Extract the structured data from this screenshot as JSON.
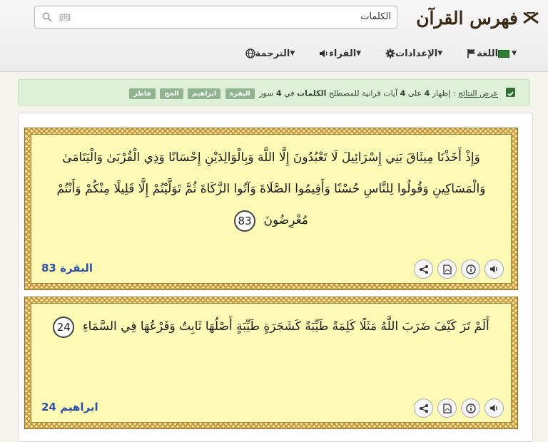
{
  "header": {
    "logo": "فهرس القرآن",
    "search": {
      "value": "الكلمات"
    },
    "nav": [
      {
        "label": "الترجمة",
        "icon": "globe-icon"
      },
      {
        "label": "القراء",
        "icon": "speaker-icon"
      },
      {
        "label": "الإعدادات",
        "icon": "gear-icon"
      },
      {
        "label": "اللغة",
        "icon": "flag-icon"
      }
    ]
  },
  "alert": {
    "label": "عرض النتائج",
    "p1": ": إظهار",
    "shown": "4",
    "p2": "على",
    "total": "4",
    "p3": "آيات قرانية للمصطلح",
    "term": "الكلمات",
    "p4": "في",
    "surah_count": "4",
    "p5": "سور",
    "tags": [
      "البقرة",
      "ابراهيم",
      "الحج",
      "فاطر"
    ]
  },
  "verses": [
    {
      "text": "وَإِذْ أَخَذْنَا مِيثَاقَ بَنِي إِسْرَائِيلَ لَا تَعْبُدُونَ إِلَّا اللَّهَ وَبِالْوَالِدَيْنِ إِحْسَانًا وَذِي الْقُرْبَىٰ وَالْيَتَامَىٰ وَالْمَسَاكِينِ وَقُولُوا لِلنَّاسِ حُسْنًا وَأَقِيمُوا الصَّلَاةَ وَآتُوا الزَّكَاةَ ثُمَّ تَوَلَّيْتُمْ إِلَّا قَلِيلًا مِنْكُمْ وَأَنْتُمْ مُعْرِضُونَ",
      "number": "83",
      "reference": "البقرة 83"
    },
    {
      "text": "أَلَمْ تَرَ كَيْفَ ضَرَبَ اللَّهُ مَثَلًا كَلِمَةً طَيِّبَةً كَشَجَرَةٍ طَيِّبَةٍ أَصْلُهَا ثَابِتٌ وَفَرْعُهَا فِي السَّمَاءِ",
      "number": "24",
      "reference": "ابراهيم 24"
    }
  ],
  "action_icons": [
    "speaker-icon",
    "info-icon",
    "pdf-icon",
    "share-icon"
  ]
}
